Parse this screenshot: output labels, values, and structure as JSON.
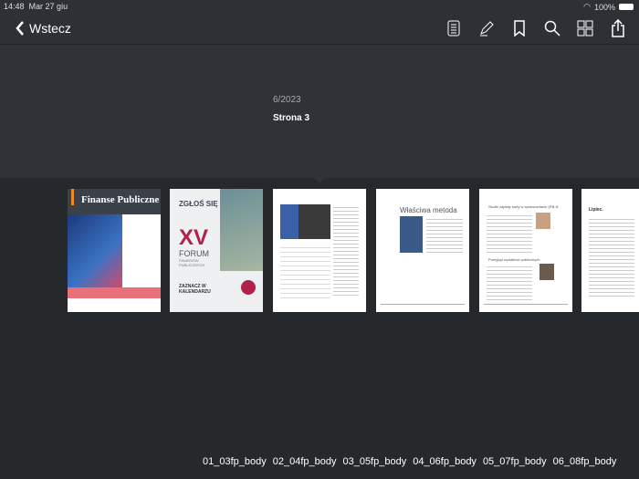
{
  "status": {
    "time": "14:48",
    "date": "Mar 27 giu",
    "battery": "100%"
  },
  "nav": {
    "back_label": "Wstecz",
    "icons": [
      "list-icon",
      "pencil-icon",
      "bookmark-icon",
      "search-icon",
      "thumbnails-icon",
      "share-icon"
    ]
  },
  "issue": "6/2023",
  "page": "Strona 3",
  "thumbs": {
    "t1": {
      "title": "Finanse Publiczne"
    },
    "t2": {
      "line1": "ZGŁOŚ SIĘ",
      "big": "XV",
      "line2": "FORUM",
      "line3": "FINANSÓW PUBLICZNYCH",
      "cta": "ZAZNACZ W KALENDARZU"
    },
    "t4": {
      "title": "Właściwa metoda"
    },
    "t5": {
      "title1": "Skutki zapłaty karty w sprawozdaniu (RB-N",
      "title2": "Przegląd wydatków publicznych"
    },
    "t6": {
      "title": "Lipiec."
    }
  },
  "labels": [
    "01_03fp_body",
    "02_04fp_body",
    "03_05fp_body",
    "04_06fp_body",
    "05_07fp_body",
    "06_08fp_body"
  ],
  "colors": {
    "accent": "#e0565b"
  }
}
